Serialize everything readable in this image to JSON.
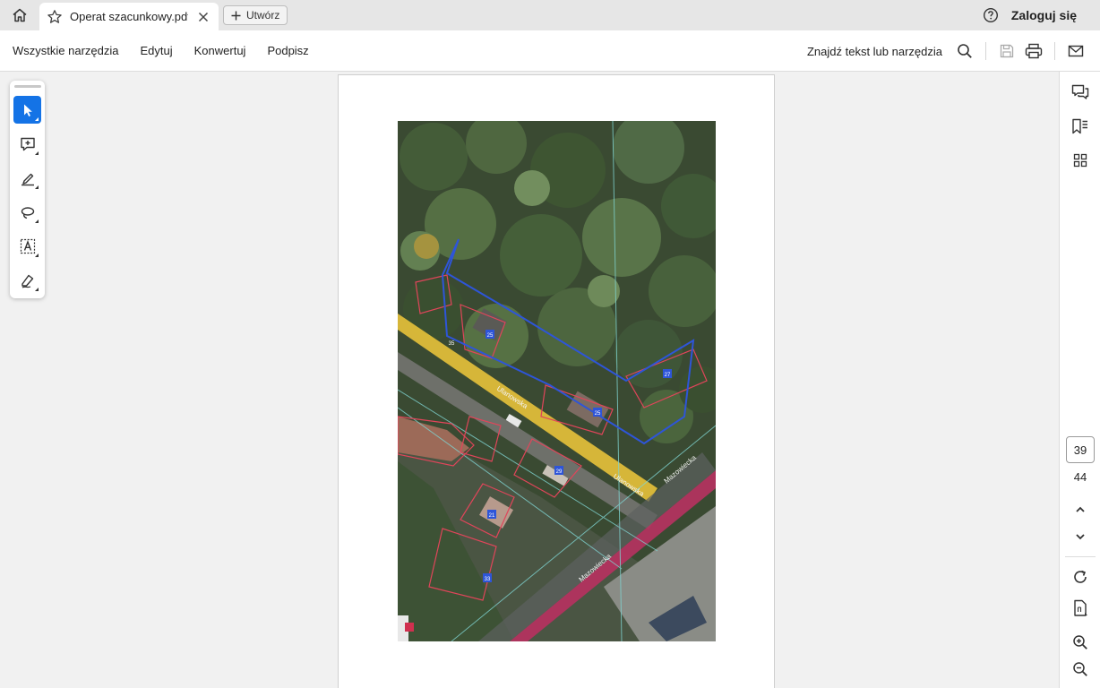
{
  "tabbar": {
    "tab_title": "Operat szacunkowy.pdf",
    "create_label": "Utwórz",
    "signin_label": "Zaloguj się"
  },
  "menubar": {
    "items": [
      "Wszystkie narzędzia",
      "Edytuj",
      "Konwertuj",
      "Podpisz"
    ],
    "find_label": "Znajdź tekst lub narzędzia"
  },
  "tools": [
    {
      "icon": "select-arrow-icon",
      "active": true
    },
    {
      "icon": "add-comment-icon",
      "active": false
    },
    {
      "icon": "highlight-pen-icon",
      "active": false
    },
    {
      "icon": "draw-lasso-icon",
      "active": false
    },
    {
      "icon": "text-select-icon",
      "active": false
    },
    {
      "icon": "sign-pen-icon",
      "active": false
    }
  ],
  "pagination": {
    "current_page": "39",
    "total_pages": "44"
  },
  "map": {
    "street_labels": [
      "Mazowiecka",
      "Mazowiecka",
      "Ulanowska",
      "Ulanowska"
    ],
    "parcel_labels": [
      "25",
      "25",
      "27",
      "29",
      "21",
      "33",
      "35"
    ]
  },
  "colors": {
    "accent": "#1473e6",
    "parcel_outline": "#e0455a",
    "plot_outline": "#2e55d8",
    "road_yellow": "#e8c23a",
    "road_magenta": "#b5325f"
  }
}
